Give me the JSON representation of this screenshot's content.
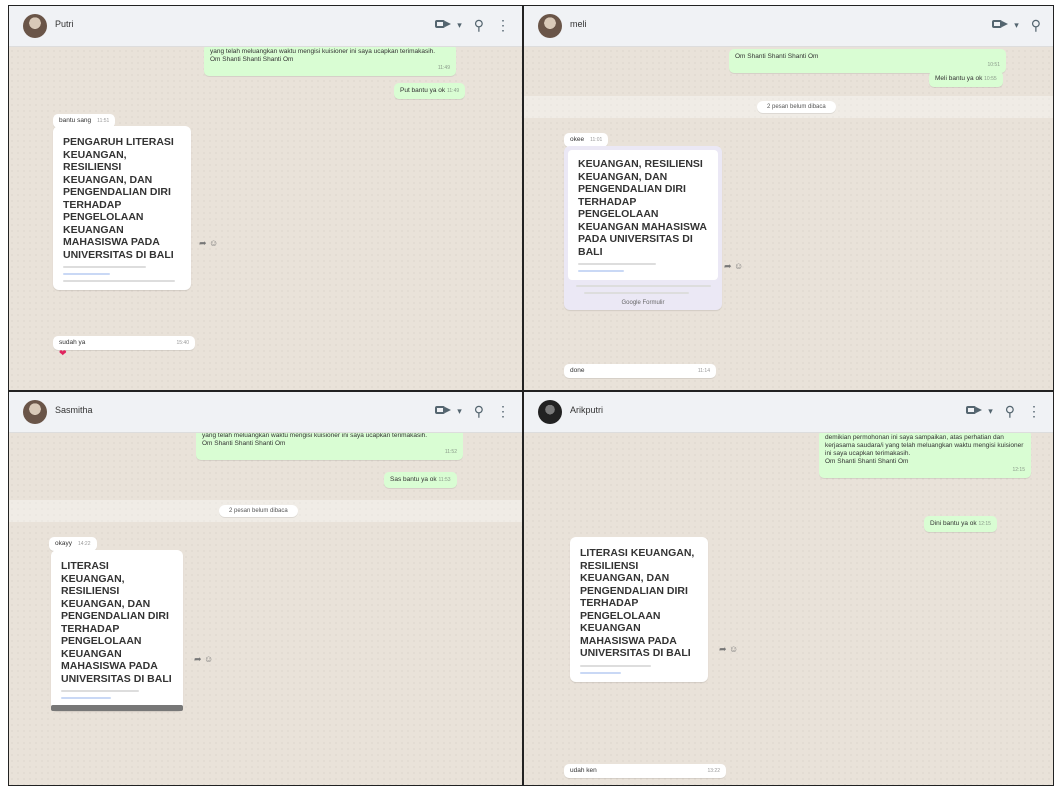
{
  "panels": [
    {
      "contact": "Putri",
      "out_messages": [
        {
          "text": "yang telah meluangkan waktu mengisi kuisioner ini saya ucapkan terimakasih.",
          "text2": "Om Shanti Shanti Shanti Om",
          "time": "11:49"
        },
        {
          "text": "Put bantu ya ok",
          "time": "11:49"
        }
      ],
      "in_label": {
        "text": "bantu sang",
        "time": "11:51"
      },
      "form_title": "PENGARUH LITERASI KEUANGAN, RESILIENSI KEUANGAN, DAN PENGENDALIAN DIRI TERHADAP PENGELOLAAN KEUANGAN MAHASISWA PADA UNIVERSITAS DI BALI",
      "reply": {
        "text": "sudah ya",
        "time": "15:40"
      },
      "reaction": "❤"
    },
    {
      "contact": "meli",
      "out_messages": [
        {
          "text": "Om Shanti Shanti Shanti Om",
          "time": "10:51"
        },
        {
          "text": "Meli bantu ya ok",
          "time": "10:55"
        }
      ],
      "notice": "2 pesan belum dibaca",
      "in_label": {
        "text": "okee",
        "time": "11:01"
      },
      "form_title": "KEUANGAN, RESILIENSI KEUANGAN, DAN PENGENDALIAN DIRI TERHADAP PENGELOLAAN KEUANGAN MAHASISWA PADA UNIVERSITAS DI BALI",
      "google_forms": "Google Formulir",
      "reply": {
        "text": "done",
        "time": "11:14"
      }
    },
    {
      "contact": "Sasmitha",
      "out_messages": [
        {
          "text": "yang telah meluangkan waktu mengisi kuisioner ini saya ucapkan terimakasih.",
          "text2": "Om Shanti Shanti Shanti Om",
          "time": "11:52"
        },
        {
          "text": "Sas bantu ya ok",
          "time": "11:53"
        }
      ],
      "notice": "2 pesan belum dibaca",
      "in_label": {
        "text": "okayy",
        "time": "14:22"
      },
      "form_title": "LITERASI KEUANGAN, RESILIENSI KEUANGAN, DAN PENGENDALIAN DIRI TERHADAP PENGELOLAAN KEUANGAN MAHASISWA PADA UNIVERSITAS DI BALI"
    },
    {
      "contact": "Arikputri",
      "out_messages": [
        {
          "text": "demikian permohonan ini saya sampaikan, atas perhatian dan kerjasama saudara/i yang telah meluangkan waktu mengisi kuisioner ini saya ucapkan terimakasih.",
          "text2": "Om Shanti Shanti Shanti Om",
          "time": "12:15"
        },
        {
          "text": "Dini bantu ya ok",
          "time": "12:15"
        }
      ],
      "form_title": "LITERASI KEUANGAN, RESILIENSI KEUANGAN, DAN PENGENDALIAN DIRI TERHADAP PENGELOLAAN KEUANGAN MAHASISWA PADA UNIVERSITAS DI BALI",
      "reply": {
        "text": "udah ken",
        "time": "13:22"
      }
    }
  ],
  "icons": {
    "video": "video-call-icon",
    "search": "search-icon",
    "menu": "more-vertical-icon",
    "forward": "forward-icon",
    "emoji": "emoji-icon"
  },
  "colors": {
    "outgoing": "#d9fdd3",
    "incoming": "#ffffff",
    "chat_bg": "#e9e2d9",
    "header": "#f0f2f5"
  }
}
